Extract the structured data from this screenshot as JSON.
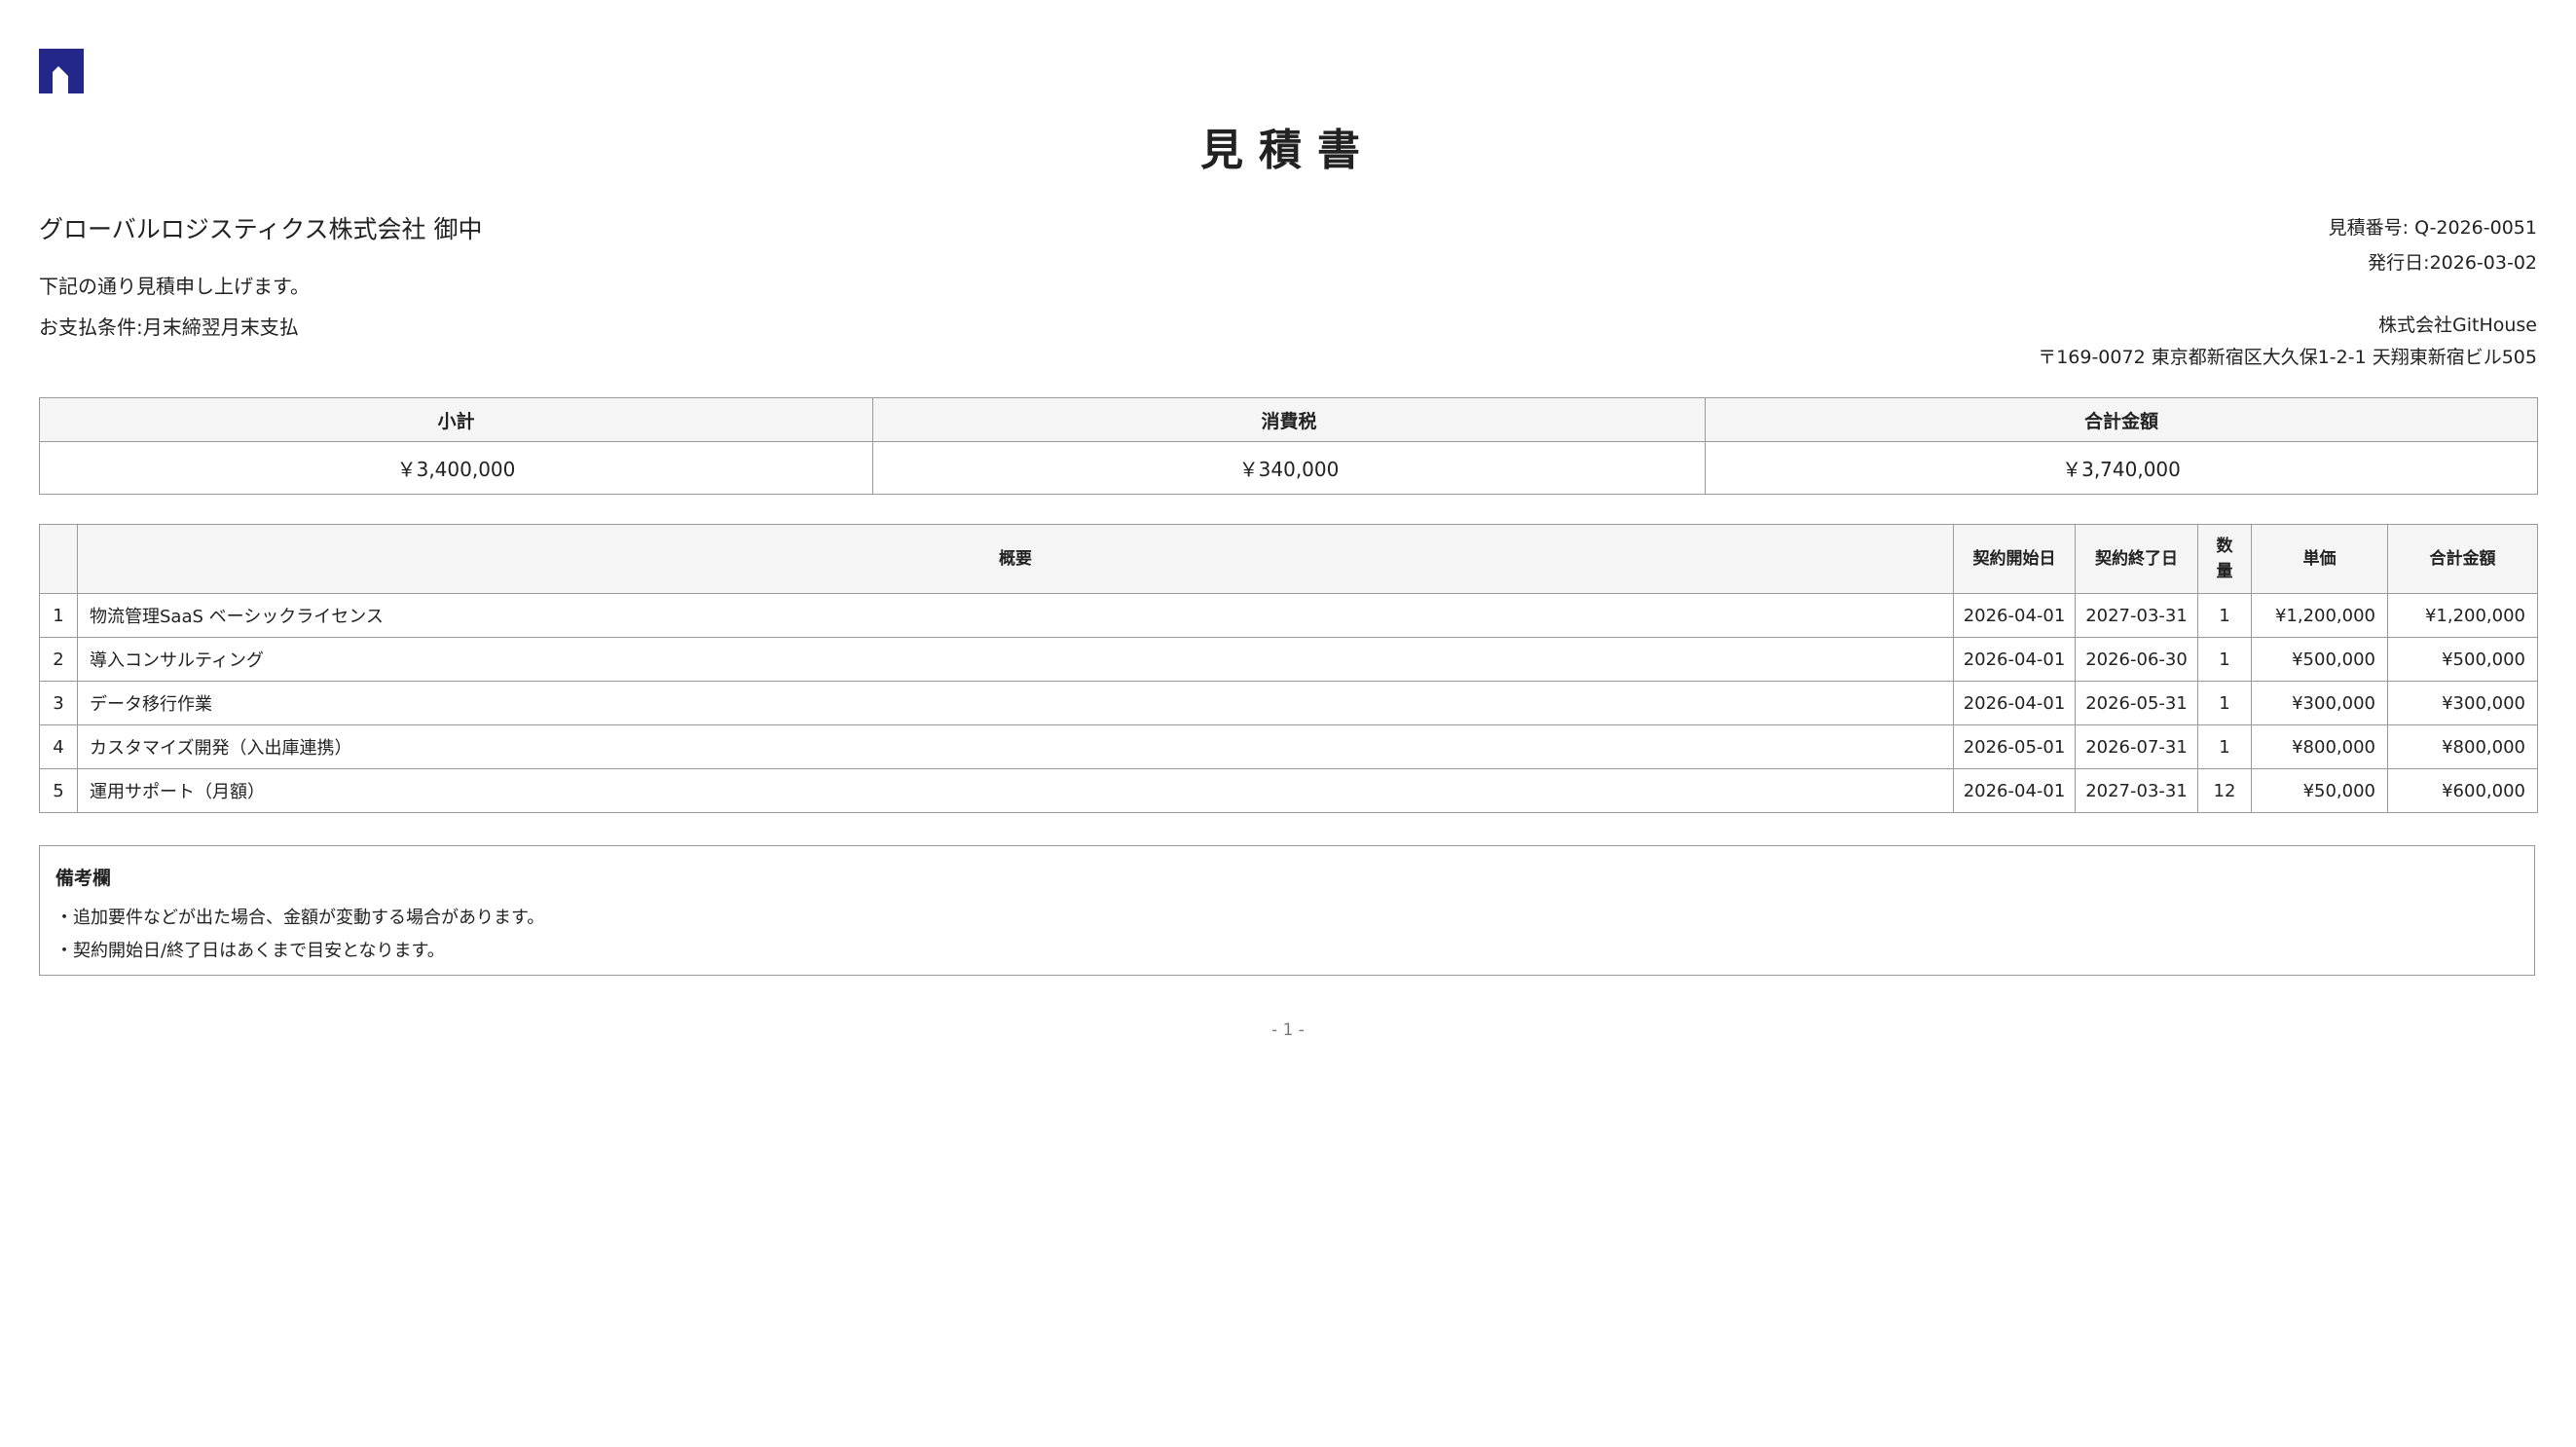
{
  "document": {
    "title": "見積書",
    "client": "グローバルロジスティクス株式会社 御中",
    "intro": "下記の通り見積申し上げます。",
    "payment_terms": "お支払条件:月末締翌月末支払",
    "quote_number": "見積番号: Q-2026-0051",
    "issue_date": "発行日:2026-03-02",
    "issuer_company": "株式会社GitHouse",
    "issuer_address": "〒169-0072 東京都新宿区大久保1-2-1 天翔東新宿ビル505"
  },
  "summary": {
    "headers": [
      "小計",
      "消費税",
      "合計金額"
    ],
    "values": [
      "￥3,400,000",
      "￥340,000",
      "￥3,740,000"
    ]
  },
  "items": {
    "headers": {
      "no": "",
      "description": "概要",
      "start_date": "契約開始日",
      "end_date": "契約終了日",
      "quantity": "数量",
      "unit_price": "単価",
      "total": "合計金額"
    },
    "rows": [
      {
        "no": "1",
        "description": "物流管理SaaS ベーシックライセンス",
        "start_date": "2026-04-01",
        "end_date": "2027-03-31",
        "quantity": "1",
        "unit_price": "¥1,200,000",
        "total": "¥1,200,000"
      },
      {
        "no": "2",
        "description": "導入コンサルティング",
        "start_date": "2026-04-01",
        "end_date": "2026-06-30",
        "quantity": "1",
        "unit_price": "¥500,000",
        "total": "¥500,000"
      },
      {
        "no": "3",
        "description": "データ移行作業",
        "start_date": "2026-04-01",
        "end_date": "2026-05-31",
        "quantity": "1",
        "unit_price": "¥300,000",
        "total": "¥300,000"
      },
      {
        "no": "4",
        "description": "カスタマイズ開発（入出庫連携）",
        "start_date": "2026-05-01",
        "end_date": "2026-07-31",
        "quantity": "1",
        "unit_price": "¥800,000",
        "total": "¥800,000"
      },
      {
        "no": "5",
        "description": "運用サポート（月額）",
        "start_date": "2026-04-01",
        "end_date": "2027-03-31",
        "quantity": "12",
        "unit_price": "¥50,000",
        "total": "¥600,000"
      }
    ]
  },
  "remarks": {
    "title": "備考欄",
    "lines": [
      "・追加要件などが出た場合、金額が変動する場合があります。",
      "・契約開始日/終了日はあくまで目安となります。"
    ]
  },
  "footer": {
    "page_number": "- 1 -"
  },
  "colors": {
    "logo": "#24278a",
    "border": "#9a9a9a",
    "header_bg": "#f5f5f5"
  },
  "icons": {
    "logo": "house-logo-icon"
  }
}
